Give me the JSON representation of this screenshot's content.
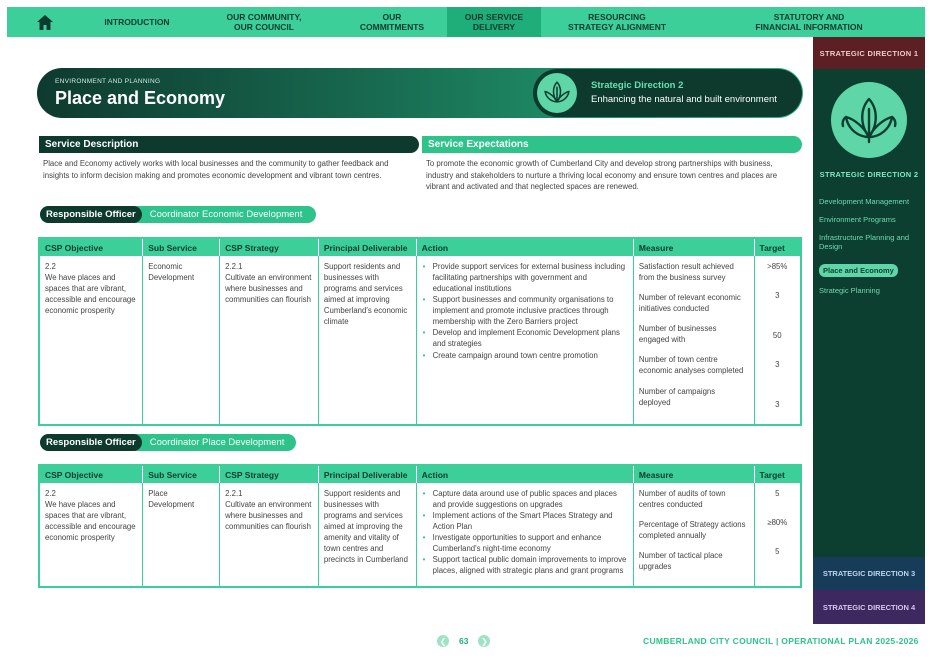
{
  "nav": {
    "items": [
      {
        "line1": "INTRODUCTION",
        "line2": ""
      },
      {
        "line1": "OUR COMMUNITY,",
        "line2": "OUR COUNCIL"
      },
      {
        "line1": "OUR",
        "line2": "COMMITMENTS"
      },
      {
        "line1": "OUR SERVICE",
        "line2": "DELIVERY"
      },
      {
        "line1": "RESOURCING",
        "line2": "STRATEGY ALIGNMENT"
      },
      {
        "line1": "STATUTORY AND",
        "line2": "FINANCIAL INFORMATION"
      }
    ]
  },
  "sidebar": {
    "direction1": "STRATEGIC DIRECTION 1",
    "direction2": "STRATEGIC DIRECTION 2",
    "direction3": "STRATEGIC DIRECTION 3",
    "direction4": "STRATEGIC DIRECTION 4",
    "links": [
      "Development Management",
      "Environment Programs",
      "Infrastructure Planning and Design",
      "Place and Economy",
      "Strategic Planning"
    ]
  },
  "header": {
    "subtitle": "ENVIRONMENT AND PLANNING",
    "title": "Place and Economy",
    "direction": "Strategic Direction 2",
    "direction_desc": "Enhancing the natural and built environment"
  },
  "service": {
    "desc_title": "Service Description",
    "desc_text": "Place and Economy actively works with local businesses and the community to gather feedback and insights to inform decision making and promotes economic development and vibrant town centres.",
    "exp_title": "Service Expectations",
    "exp_text": "To promote the economic growth of Cumberland City and develop strong partnerships with business, industry and stakeholders to nurture a thriving local economy and ensure town centres and places are vibrant and activated and that neglected spaces are renewed."
  },
  "officer1": {
    "label": "Responsible Officer",
    "value": "Coordinator Economic Development"
  },
  "officer2": {
    "label": "Responsible Officer",
    "value": "Coordinator Place Development"
  },
  "table_headers": [
    "CSP Objective",
    "Sub Service",
    "CSP Strategy",
    "Principal Deliverable",
    "Action",
    "Measure",
    "Target"
  ],
  "table1": {
    "csp_objective_code": "2.2",
    "csp_objective": "We have places and spaces that are vibrant, accessible and encourage economic prosperity",
    "sub_service": "Economic Development",
    "strategy_code": "2.2.1",
    "strategy": "Cultivate an environment where businesses and communities can flourish",
    "deliverable": "Support residents and businesses with programs and services aimed at improving Cumberland's economic climate",
    "actions": [
      "Provide support services for external business including facilitating partnerships with government and educational institutions",
      "Support businesses and community organisations to implement and promote inclusive practices through membership with the Zero Barriers project",
      "Develop and implement Economic Development plans and strategies",
      "Create campaign around town centre promotion"
    ],
    "measures": [
      "Satisfaction result achieved from the business survey",
      "Number of relevant economic initiatives conducted",
      "Number of businesses engaged with",
      "Number of town centre economic analyses completed",
      "Number of campaigns deployed"
    ],
    "targets": [
      ">85%",
      "3",
      "50",
      "3",
      "3"
    ]
  },
  "table2": {
    "csp_objective_code": "2.2",
    "csp_objective": "We have places and spaces that are vibrant, accessible and encourage economic prosperity",
    "sub_service": "Place Development",
    "strategy_code": "2.2.1",
    "strategy": "Cultivate an environment where businesses and communities can flourish",
    "deliverable": "Support residents and businesses with programs and services aimed at improving the amenity and vitality of town centres and precincts in Cumberland",
    "actions": [
      "Capture data around use of public spaces and places and provide suggestions on upgrades",
      "Implement actions of the Smart Places Strategy and Action Plan",
      "Investigate opportunities to support and enhance Cumberland's night-time economy",
      "Support tactical public domain improvements to improve places, aligned with strategic plans and grant programs"
    ],
    "measures": [
      "Number of audits of town centres conducted",
      "Percentage of Strategy actions completed annually",
      "Number of tactical place upgrades"
    ],
    "targets": [
      "5",
      "≥80%",
      "5"
    ]
  },
  "footer": {
    "page": "63",
    "org": "CUMBERLAND CITY COUNCIL  |  OPERATIONAL PLAN 2025-2026"
  },
  "colors": {
    "primary_green": "#3dcf9a",
    "dark_green": "#0e3a2e",
    "accent": "#2ec38a"
  }
}
